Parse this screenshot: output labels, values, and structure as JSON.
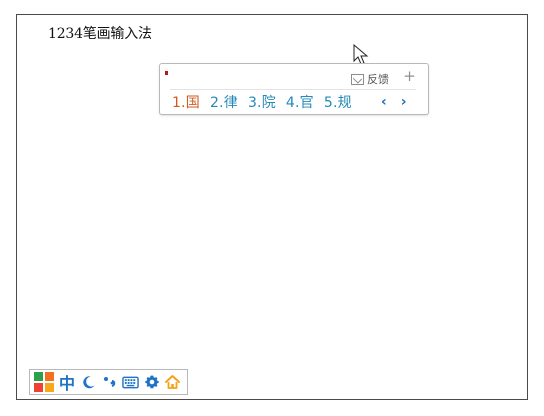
{
  "window": {
    "title": "1234笔画输入法"
  },
  "ime": {
    "marker_color": "#b51a1a",
    "feedback_label": "反馈",
    "icons": {
      "feedback": "mail-icon",
      "pin": "pin-icon",
      "prev": "chevron-left-icon",
      "next": "chevron-right-icon"
    },
    "candidates": [
      {
        "label": "1.国",
        "active": true
      },
      {
        "label": "2.律",
        "active": false
      },
      {
        "label": "3.院",
        "active": false
      },
      {
        "label": "4.官",
        "active": false
      },
      {
        "label": "5.规",
        "active": false
      }
    ],
    "prev_symbol": "‹",
    "next_symbol": "›"
  },
  "status_bar": {
    "mode_label": "中",
    "icons": [
      "logo-icon",
      "moon-icon",
      "punctuation-icon",
      "keyboard-icon",
      "gear-icon",
      "home-icon"
    ],
    "colors": {
      "accent": "#1f73c6",
      "home": "#f5a21b"
    }
  },
  "colors": {
    "candidate": "#2389b8",
    "candidate_active": "#d05a1f",
    "window_border": "#4a4a4a"
  }
}
